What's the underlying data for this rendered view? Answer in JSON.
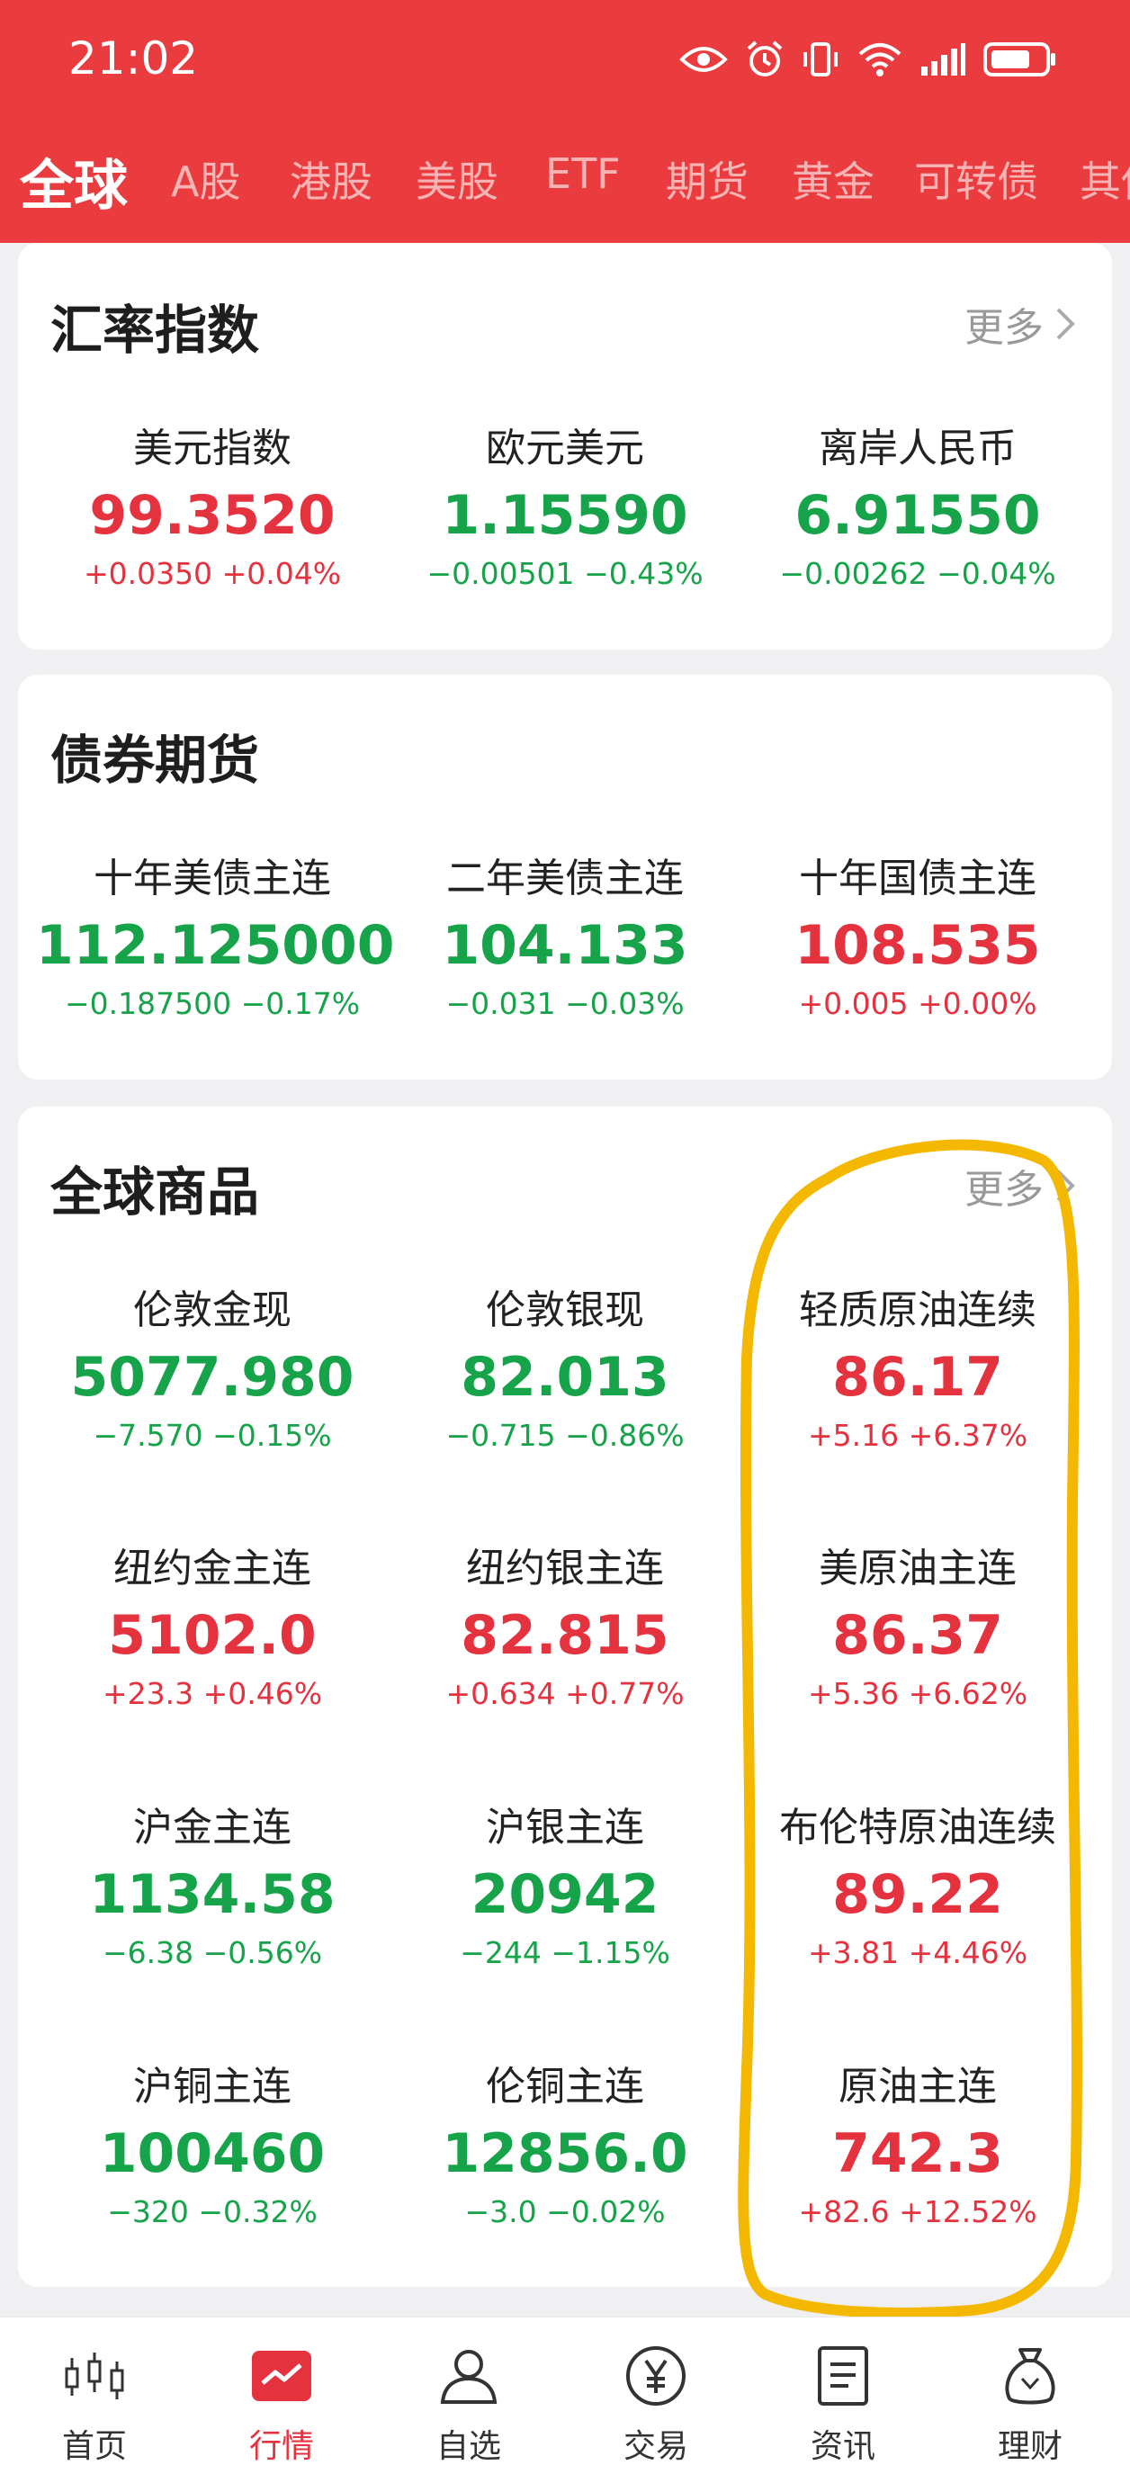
{
  "status_bar": {
    "time": "21:02"
  },
  "tabs": [
    {
      "label": "全球",
      "active": true
    },
    {
      "label": "A股"
    },
    {
      "label": "港股"
    },
    {
      "label": "美股"
    },
    {
      "label": "ETF"
    },
    {
      "label": "期货"
    },
    {
      "label": "黄金"
    },
    {
      "label": "可转债"
    },
    {
      "label": "其他"
    }
  ],
  "exchange": {
    "title": "汇率指数",
    "more": "更多",
    "items": [
      {
        "name": "美元指数",
        "price": "99.3520",
        "change": "+0.0350",
        "pct": "+0.04%",
        "dir": "up"
      },
      {
        "name": "欧元美元",
        "price": "1.15590",
        "change": "−0.00501",
        "pct": "−0.43%",
        "dir": "down"
      },
      {
        "name": "离岸人民币",
        "price": "6.91550",
        "change": "−0.00262",
        "pct": "−0.04%",
        "dir": "down"
      }
    ]
  },
  "bonds": {
    "title": "债券期货",
    "items": [
      {
        "name": "十年美债主连",
        "price": "112.125000",
        "change": "−0.187500",
        "pct": "−0.17%",
        "dir": "down"
      },
      {
        "name": "二年美债主连",
        "price": "104.133",
        "change": "−0.031",
        "pct": "−0.03%",
        "dir": "down"
      },
      {
        "name": "十年国债主连",
        "price": "108.535",
        "change": "+0.005",
        "pct": "+0.00%",
        "dir": "up"
      }
    ]
  },
  "commodities": {
    "title": "全球商品",
    "more": "更多",
    "items": [
      {
        "name": "伦敦金现",
        "price": "5077.980",
        "change": "−7.570",
        "pct": "−0.15%",
        "dir": "down"
      },
      {
        "name": "伦敦银现",
        "price": "82.013",
        "change": "−0.715",
        "pct": "−0.86%",
        "dir": "down"
      },
      {
        "name": "轻质原油连续",
        "price": "86.17",
        "change": "+5.16",
        "pct": "+6.37%",
        "dir": "up"
      },
      {
        "name": "纽约金主连",
        "price": "5102.0",
        "change": "+23.3",
        "pct": "+0.46%",
        "dir": "up"
      },
      {
        "name": "纽约银主连",
        "price": "82.815",
        "change": "+0.634",
        "pct": "+0.77%",
        "dir": "up"
      },
      {
        "name": "美原油主连",
        "price": "86.37",
        "change": "+5.36",
        "pct": "+6.62%",
        "dir": "up"
      },
      {
        "name": "沪金主连",
        "price": "1134.58",
        "change": "−6.38",
        "pct": "−0.56%",
        "dir": "down"
      },
      {
        "name": "沪银主连",
        "price": "20942",
        "change": "−244",
        "pct": "−1.15%",
        "dir": "down"
      },
      {
        "name": "布伦特原油连续",
        "price": "89.22",
        "change": "+3.81",
        "pct": "+4.46%",
        "dir": "up"
      },
      {
        "name": "沪铜主连",
        "price": "100460",
        "change": "−320",
        "pct": "−0.32%",
        "dir": "down"
      },
      {
        "name": "伦铜主连",
        "price": "12856.0",
        "change": "−3.0",
        "pct": "−0.02%",
        "dir": "down"
      },
      {
        "name": "原油主连",
        "price": "742.3",
        "change": "+82.6",
        "pct": "+12.52%",
        "dir": "up"
      }
    ]
  },
  "bottom_nav": [
    {
      "label": "首页",
      "icon": "candlestick-icon"
    },
    {
      "label": "行情",
      "icon": "chart-icon",
      "active": true
    },
    {
      "label": "自选",
      "icon": "user-icon"
    },
    {
      "label": "交易",
      "icon": "yen-icon"
    },
    {
      "label": "资讯",
      "icon": "document-icon"
    },
    {
      "label": "理财",
      "icon": "money-bag-icon"
    }
  ],
  "colors": {
    "brand_red": "#ea3b3e",
    "up": "#e5323f",
    "down": "#16a34a",
    "highlight": "#f5b800"
  }
}
